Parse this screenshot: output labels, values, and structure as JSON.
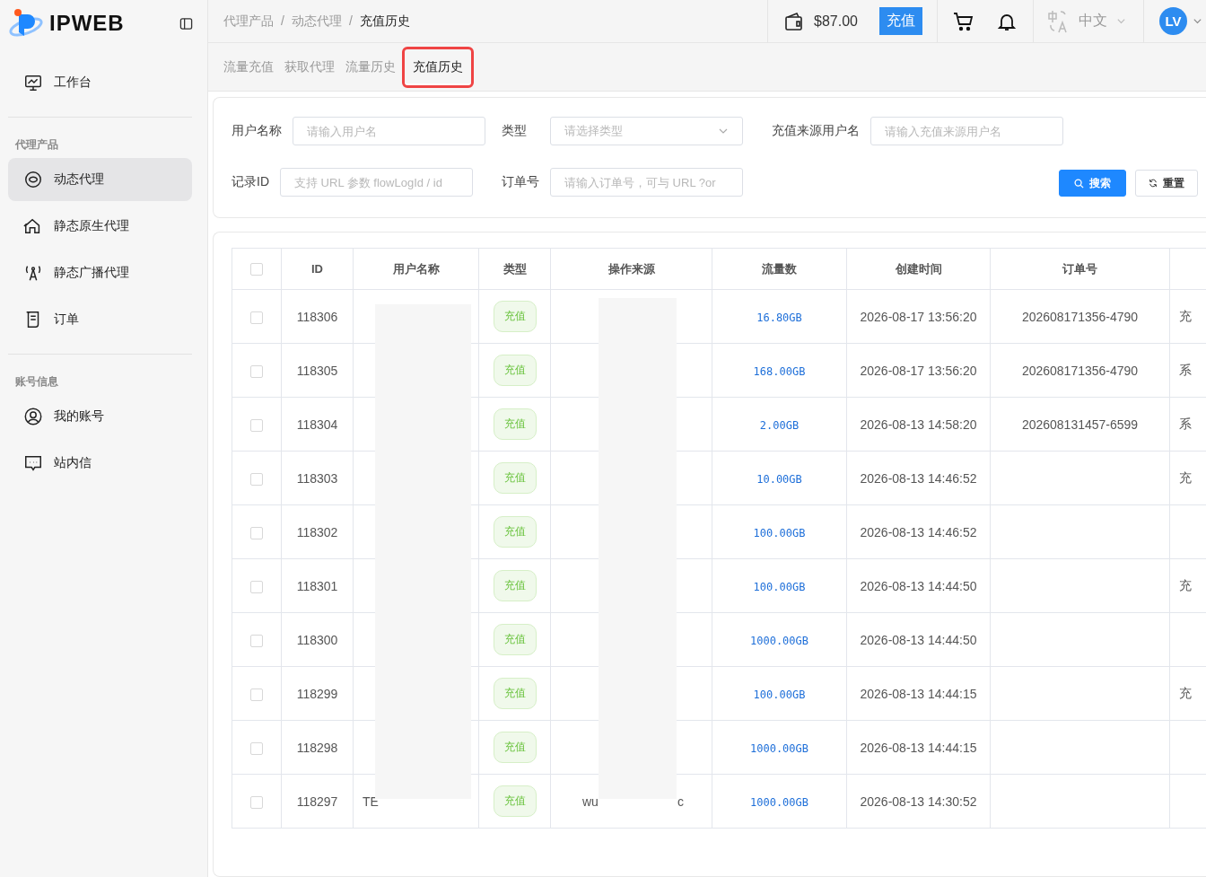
{
  "brand": {
    "name": "IPWEB"
  },
  "sidebar": {
    "sections": [
      {
        "items": [
          {
            "label": "工作台",
            "selected": false
          }
        ]
      },
      {
        "title": "代理产品",
        "items": [
          {
            "label": "动态代理",
            "selected": true
          },
          {
            "label": "静态原生代理",
            "selected": false
          },
          {
            "label": "静态广播代理",
            "selected": false
          },
          {
            "label": "订单",
            "selected": false
          }
        ]
      },
      {
        "title": "账号信息",
        "items": [
          {
            "label": "我的账号",
            "selected": false
          },
          {
            "label": "站内信",
            "selected": false
          }
        ]
      }
    ]
  },
  "breadcrumbs": {
    "separator": "/",
    "items": [
      "代理产品",
      "动态代理",
      "充值历史"
    ]
  },
  "header": {
    "balance": "$87.00",
    "recharge_button": "充值",
    "language": "中文",
    "avatar": "LV"
  },
  "tabs": [
    {
      "label": "流量充值",
      "selected": false
    },
    {
      "label": "获取代理",
      "selected": false
    },
    {
      "label": "流量历史",
      "selected": false
    },
    {
      "label": "充值历史",
      "selected": true
    }
  ],
  "filters": [
    {
      "label": "用户名称",
      "kind": "input",
      "placeholder": "请输入用户名"
    },
    {
      "label": "类型",
      "kind": "select",
      "placeholder": "请选择类型"
    },
    {
      "label": "充值来源用户名",
      "kind": "input",
      "placeholder": "请输入充值来源用户名"
    },
    {
      "label": "记录ID",
      "kind": "input",
      "placeholder": "支持 URL 参数 flowLogId / id"
    },
    {
      "label": "订单号",
      "kind": "input",
      "placeholder": "请输入订单号，可与 URL ?or"
    }
  ],
  "filter_buttons": {
    "search": "搜索",
    "reset": "重置"
  },
  "table": {
    "select_all_checked": false,
    "columns": [
      "ID",
      "用户名称",
      "类型",
      "操作来源",
      "流量数",
      "创建时间",
      "订单号"
    ],
    "rows": [
      {
        "checked": false,
        "id": "118306",
        "type": "充值",
        "amount": "16.80GB",
        "created": "2026-08-17 13:56:20",
        "order": "202608171356-4790",
        "column_9": "充"
      },
      {
        "checked": false,
        "id": "118305",
        "type": "充值",
        "amount": "168.00GB",
        "created": "2026-08-17 13:56:20",
        "order": "202608171356-4790",
        "column_9": "系"
      },
      {
        "checked": false,
        "id": "118304",
        "type": "充值",
        "amount": "2.00GB",
        "created": "2026-08-13 14:58:20",
        "order": "202608131457-6599",
        "column_9": "系"
      },
      {
        "checked": false,
        "id": "118303",
        "type": "充值",
        "amount": "10.00GB",
        "created": "2026-08-13 14:46:52",
        "column_9": "充"
      },
      {
        "checked": false,
        "id": "118302",
        "type": "充值",
        "amount": "100.00GB",
        "created": "2026-08-13 14:46:52"
      },
      {
        "checked": false,
        "id": "118301",
        "type": "充值",
        "amount": "100.00GB",
        "created": "2026-08-13 14:44:50",
        "column_9": "充"
      },
      {
        "checked": false,
        "id": "118300",
        "type": "充值",
        "amount": "1000.00GB",
        "created": "2026-08-13 14:44:50"
      },
      {
        "checked": false,
        "id": "118299",
        "type": "充值",
        "amount": "100.00GB",
        "created": "2026-08-13 14:44:15",
        "column_9": "充"
      },
      {
        "checked": false,
        "id": "118298",
        "type": "充值",
        "amount": "1000.00GB",
        "created": "2026-08-13 14:44:15"
      },
      {
        "checked": false,
        "id": "118297",
        "username": "TE",
        "type": "充值",
        "source": "wu",
        "source_end": "c",
        "amount": "1000.00GB",
        "created": "2026-08-13 14:30:52"
      }
    ]
  }
}
